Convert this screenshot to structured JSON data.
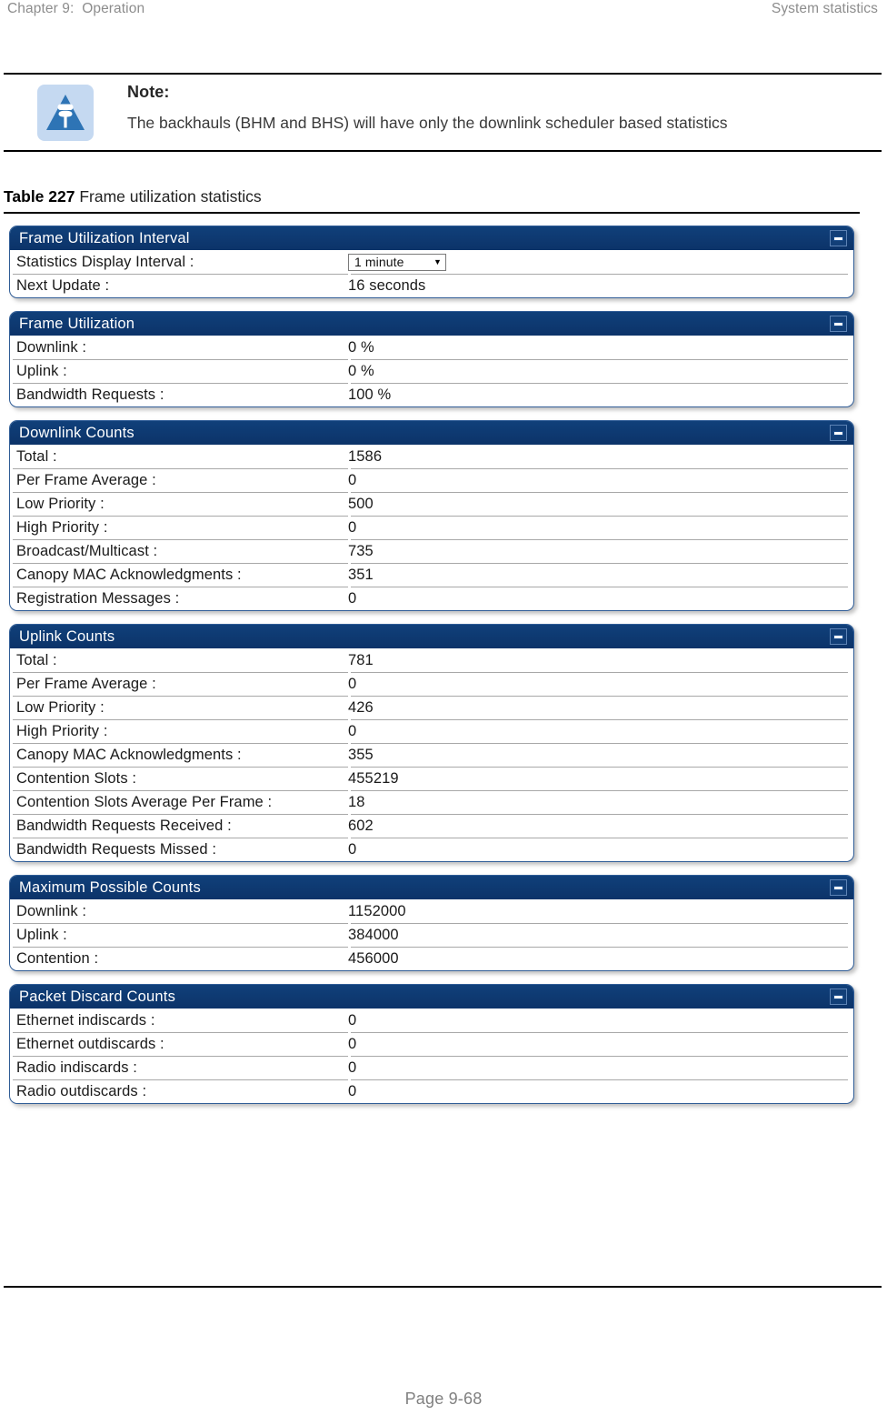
{
  "header": {
    "chapter": "Chapter 9:  Operation",
    "section": "System statistics"
  },
  "note": {
    "icon": "note-pushpin-icon",
    "title": "Note:",
    "text": "The backhauls (BHM and BHS) will have only the downlink scheduler based statistics"
  },
  "caption": {
    "number": "Table 227",
    "text": " Frame utilization statistics"
  },
  "colors": {
    "panel_header_bg": "#0e3a70",
    "panel_border": "#2f5c96",
    "note_icon_bg": "#c5d9f1",
    "note_icon_fill": "#2e74b5",
    "page_header_text": "#8d8d8d"
  },
  "panels": [
    {
      "title": "Frame Utilization Interval",
      "collapse_icon": "minimize-icon",
      "rows": [
        {
          "label": "Statistics Display Interval :",
          "value": "",
          "control": "select",
          "selected": "1 minute"
        },
        {
          "label": "Next Update :",
          "value": "16 seconds"
        }
      ]
    },
    {
      "title": "Frame Utilization",
      "collapse_icon": "minimize-icon",
      "rows": [
        {
          "label": "Downlink :",
          "value": "0 %"
        },
        {
          "label": "Uplink :",
          "value": "0 %"
        },
        {
          "label": "Bandwidth Requests :",
          "value": "100 %"
        }
      ]
    },
    {
      "title": "Downlink Counts",
      "collapse_icon": "minimize-icon",
      "rows": [
        {
          "label": "Total :",
          "value": "1586"
        },
        {
          "label": "Per Frame Average :",
          "value": "0"
        },
        {
          "label": "Low Priority :",
          "value": "500"
        },
        {
          "label": "High Priority :",
          "value": "0"
        },
        {
          "label": "Broadcast/Multicast :",
          "value": "735"
        },
        {
          "label": "Canopy MAC Acknowledgments :",
          "value": "351"
        },
        {
          "label": "Registration Messages :",
          "value": "0"
        }
      ]
    },
    {
      "title": "Uplink Counts",
      "collapse_icon": "minimize-icon",
      "rows": [
        {
          "label": "Total :",
          "value": "781"
        },
        {
          "label": "Per Frame Average :",
          "value": "0"
        },
        {
          "label": "Low Priority :",
          "value": "426"
        },
        {
          "label": "High Priority :",
          "value": "0"
        },
        {
          "label": "Canopy MAC Acknowledgments :",
          "value": "355"
        },
        {
          "label": "Contention Slots :",
          "value": "455219"
        },
        {
          "label": "Contention Slots Average Per Frame :",
          "value": "18"
        },
        {
          "label": "Bandwidth Requests Received :",
          "value": "602"
        },
        {
          "label": "Bandwidth Requests Missed :",
          "value": "0"
        }
      ]
    },
    {
      "title": "Maximum Possible Counts",
      "collapse_icon": "minimize-icon",
      "rows": [
        {
          "label": "Downlink :",
          "value": "1152000"
        },
        {
          "label": "Uplink :",
          "value": "384000"
        },
        {
          "label": "Contention :",
          "value": "456000"
        }
      ]
    },
    {
      "title": "Packet Discard Counts",
      "collapse_icon": "minimize-icon",
      "rows": [
        {
          "label": "Ethernet indiscards :",
          "value": "0"
        },
        {
          "label": "Ethernet outdiscards :",
          "value": "0"
        },
        {
          "label": "Radio indiscards :",
          "value": "0"
        },
        {
          "label": "Radio outdiscards :",
          "value": "0"
        }
      ]
    }
  ],
  "footer": {
    "page_number": "Page 9-68"
  }
}
